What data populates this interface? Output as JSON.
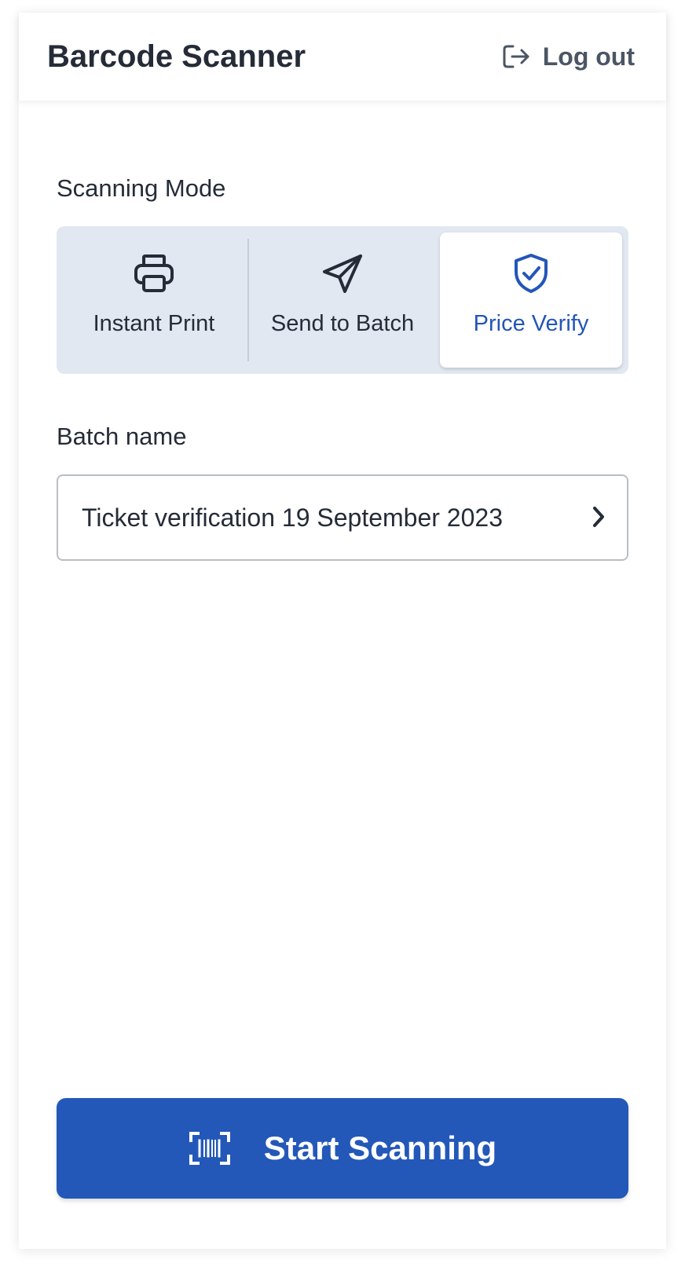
{
  "header": {
    "title": "Barcode Scanner",
    "logout_label": "Log out",
    "logout_icon": "logout-arrow-icon"
  },
  "scanning_mode": {
    "label": "Scanning Mode",
    "selected": "Price Verify",
    "options": [
      {
        "label": "Instant Print",
        "icon": "printer-icon",
        "active": false
      },
      {
        "label": "Send to Batch",
        "icon": "paper-plane-icon",
        "active": false
      },
      {
        "label": "Price Verify",
        "icon": "shield-check-icon",
        "active": true
      }
    ]
  },
  "batch": {
    "label": "Batch name",
    "value": "Ticket verification 19 September 2023",
    "icon": "chevron-right-icon"
  },
  "start_button": {
    "label": "Start Scanning",
    "icon": "barcode-scan-icon"
  },
  "colors": {
    "primary": "#2358b9",
    "active_text": "#2356b8",
    "segment_background": "#e2e8f1",
    "text": "#252c38",
    "muted_text": "#4b5565",
    "border": "#b9bec6"
  }
}
